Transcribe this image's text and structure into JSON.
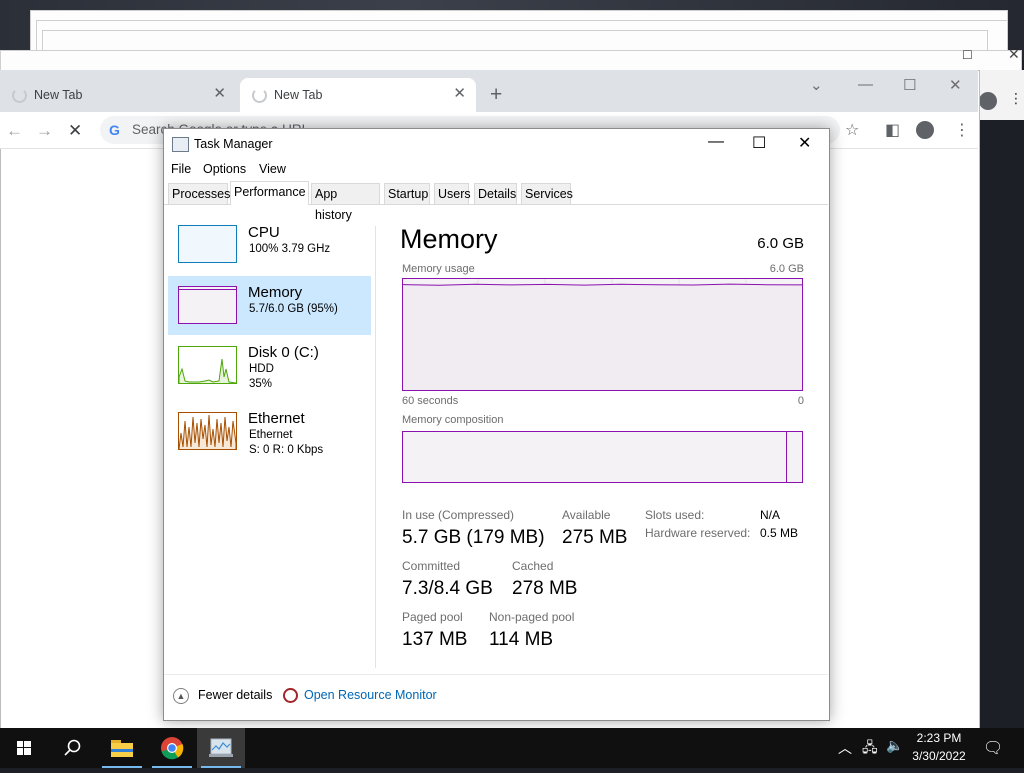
{
  "browser": {
    "tabs": [
      {
        "label": "New Tab",
        "active": false
      },
      {
        "label": "New Tab",
        "active": true
      }
    ],
    "new_tab_symbol": "+",
    "omnibox_placeholder": "Search Google or type a URL",
    "google_letter": "G"
  },
  "task_manager": {
    "title": "Task Manager",
    "menu": [
      "File",
      "Options",
      "View"
    ],
    "tabs": [
      "Processes",
      "Performance",
      "App history",
      "Startup",
      "Users",
      "Details",
      "Services"
    ],
    "selected_tab": "Performance",
    "sidebar": [
      {
        "title": "CPU",
        "sub1": "100%  3.79 GHz",
        "sub2": "",
        "color": "#117dbb"
      },
      {
        "title": "Memory",
        "sub1": "5.7/6.0 GB (95%)",
        "sub2": "",
        "color": "#8b12ae"
      },
      {
        "title": "Disk 0 (C:)",
        "sub1": "HDD",
        "sub2": "35%",
        "color": "#4da60c"
      },
      {
        "title": "Ethernet",
        "sub1": "Ethernet",
        "sub2": "S: 0  R: 0 Kbps",
        "color": "#a74f01"
      }
    ],
    "panel": {
      "title": "Memory",
      "total": "6.0 GB",
      "usage_label": "Memory usage",
      "usage_max": "6.0 GB",
      "time_left": "60 seconds",
      "time_right": "0",
      "usage_fraction": 0.95,
      "composition_label": "Memory composition",
      "stats": {
        "in_use_label": "In use (Compressed)",
        "in_use_value": "5.7 GB (179 MB)",
        "available_label": "Available",
        "available_value": "275 MB",
        "committed_label": "Committed",
        "committed_value": "7.3/8.4 GB",
        "cached_label": "Cached",
        "cached_value": "278 MB",
        "paged_label": "Paged pool",
        "paged_value": "137 MB",
        "nonpaged_label": "Non-paged pool",
        "nonpaged_value": "114 MB",
        "slots_label": "Slots used:",
        "slots_value": "N/A",
        "hw_label": "Hardware reserved:",
        "hw_value": "0.5 MB"
      }
    },
    "footer": {
      "fewer_details": "Fewer details",
      "resource_monitor": "Open Resource Monitor"
    },
    "accent": "#8b12ae"
  },
  "taskbar": {
    "time": "2:23 PM",
    "date": "3/30/2022",
    "items": [
      "windows-start-icon",
      "search-icon",
      "file-explorer-icon",
      "chrome-icon",
      "task-manager-icon"
    ]
  }
}
